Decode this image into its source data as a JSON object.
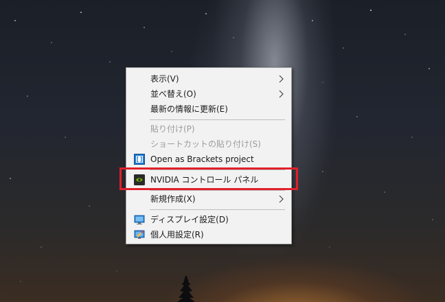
{
  "desktop": {
    "context_menu": {
      "items": [
        {
          "label": "表示(V)",
          "submenu": true
        },
        {
          "label": "並べ替え(O)",
          "submenu": true
        },
        {
          "label": "最新の情報に更新(E)"
        },
        {
          "label": "貼り付け(P)",
          "disabled": true
        },
        {
          "label": "ショートカットの貼り付け(S)",
          "disabled": true
        },
        {
          "label": "Open as Brackets project",
          "icon": "brackets-icon"
        },
        {
          "label": "NVIDIA コントロール パネル",
          "icon": "nvidia-icon"
        },
        {
          "label": "新規作成(X)",
          "submenu": true
        },
        {
          "label": "ディスプレイ設定(D)",
          "icon": "display-settings-icon"
        },
        {
          "label": "個人用設定(R)",
          "icon": "personalize-icon"
        }
      ]
    },
    "highlight_color": "#e0202a"
  }
}
